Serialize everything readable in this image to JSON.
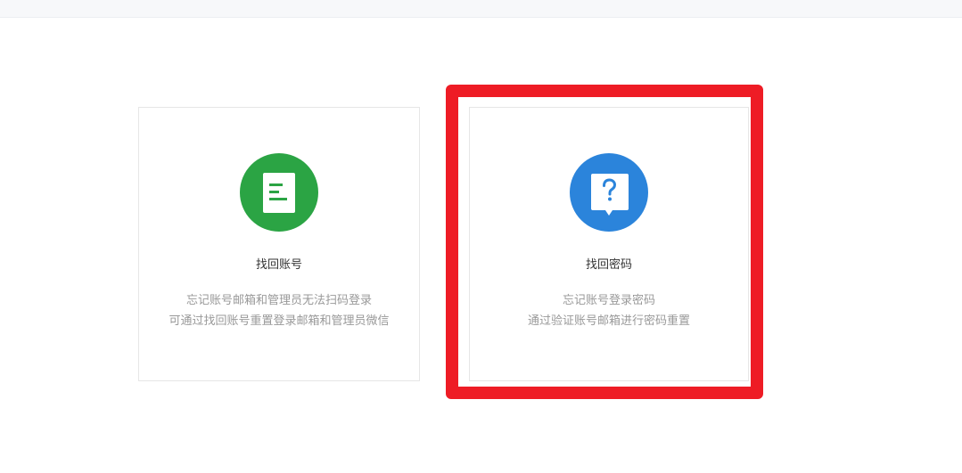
{
  "cards": [
    {
      "title": "找回账号",
      "desc_line1": "忘记账号邮箱和管理员无法扫码登录",
      "desc_line2": "可通过找回账号重置登录邮箱和管理员微信",
      "icon": "document-icon",
      "color": "#2ba444"
    },
    {
      "title": "找回密码",
      "desc_line1": "忘记账号登录密码",
      "desc_line2": "通过验证账号邮箱进行密码重置",
      "icon": "question-bubble-icon",
      "color": "#2b84db"
    }
  ],
  "highlight": {
    "color": "#ee1c25"
  }
}
